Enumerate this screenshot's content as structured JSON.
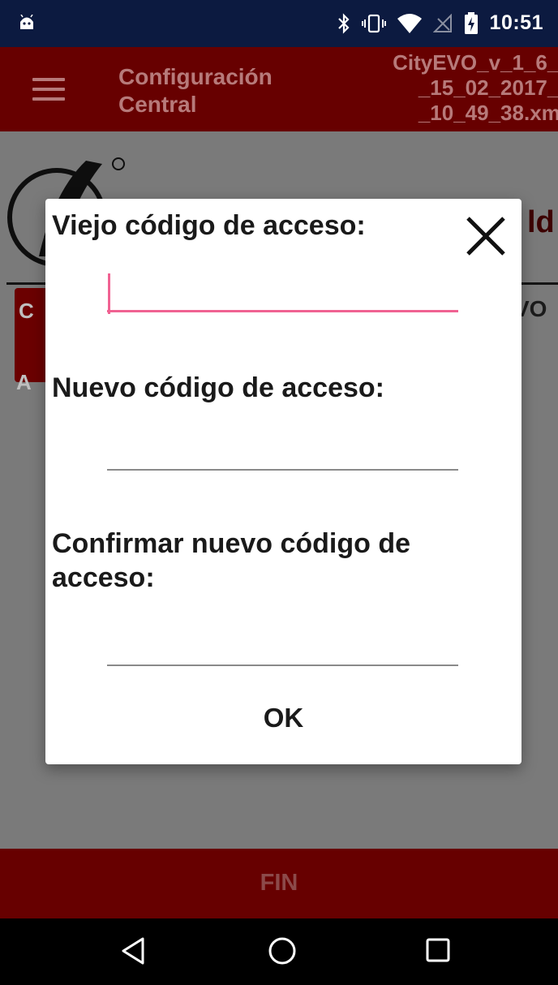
{
  "status_bar": {
    "time": "10:51",
    "icons": [
      "android-debug-icon",
      "bluetooth-icon",
      "vibrate-icon",
      "wifi-icon",
      "no-signal-icon",
      "battery-charging-icon"
    ]
  },
  "app_bar": {
    "title_line1": "Configuración",
    "title_line2": "Central",
    "file_line1": "CityEVO_v_1_6_-",
    "file_line2": "_15_02_2017_-",
    "file_line3": "_10_49_38.xml"
  },
  "background": {
    "partial_heading": "ld",
    "partial_button_top": "C",
    "partial_button_bottom": "A",
    "partial_right_text": "VO"
  },
  "dialog": {
    "old_code_label": "Viejo código de acceso:",
    "new_code_label": "Nuevo código de acceso:",
    "confirm_code_label": "Confirmar nuevo código de acceso:",
    "old_code_value": "",
    "new_code_value": "",
    "confirm_code_value": "",
    "ok_label": "OK"
  },
  "bottom_bar": {
    "fin_label": "FIN"
  },
  "colors": {
    "app_bar": "#670000",
    "status_bar": "#0c1a40",
    "focus_underline": "#f06292",
    "dim_overlay": "#7a7a7a"
  }
}
